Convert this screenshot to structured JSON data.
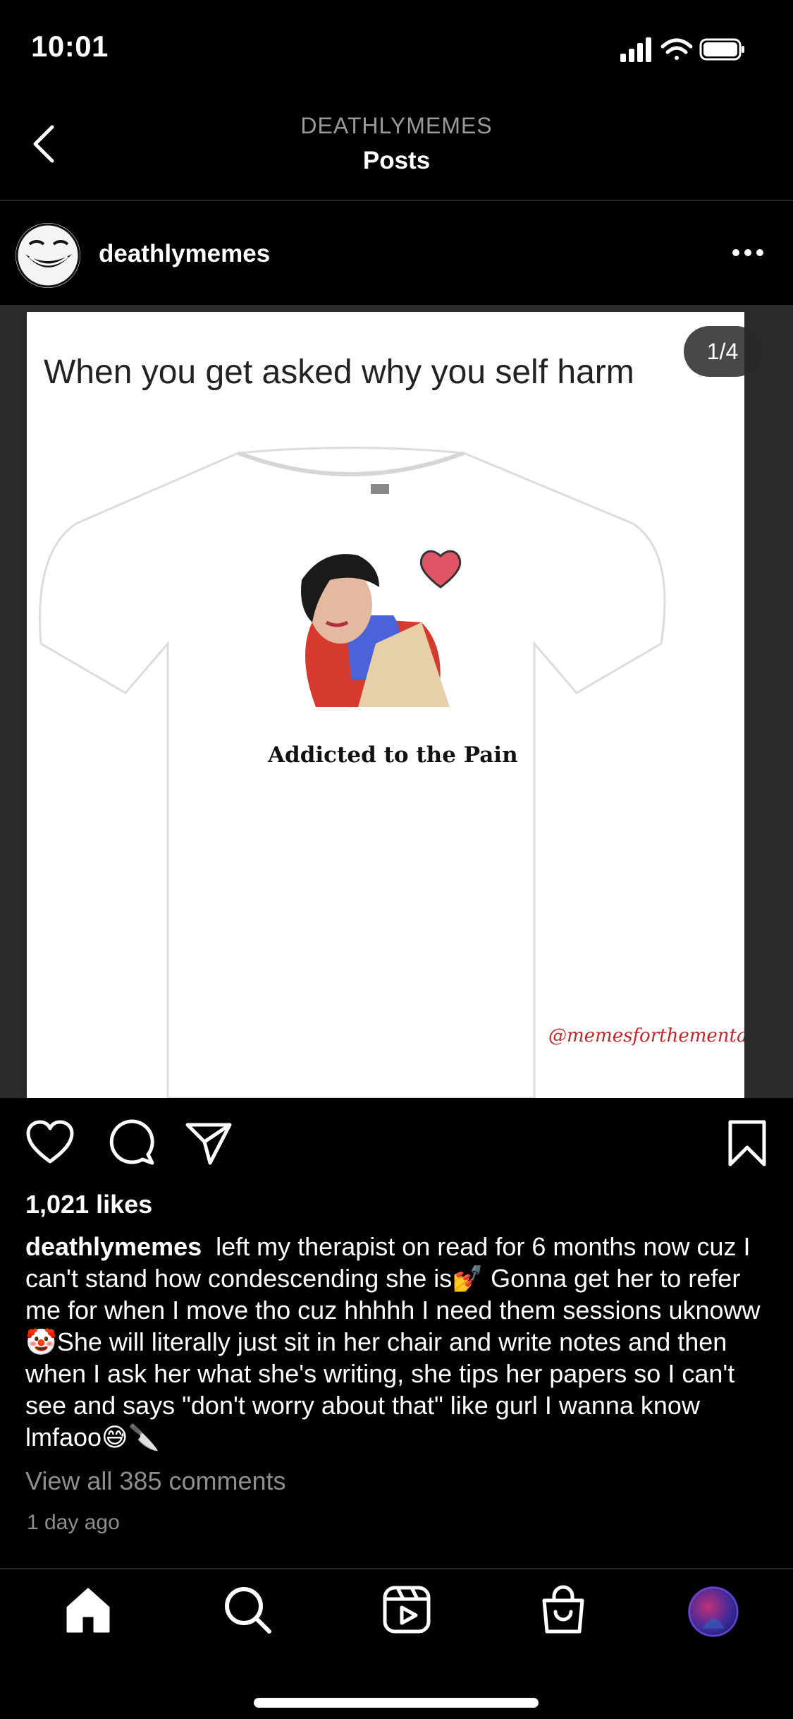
{
  "status_bar": {
    "time": "10:01"
  },
  "header": {
    "subtitle": "DEATHLYMEMES",
    "title": "Posts"
  },
  "post": {
    "username": "deathlymemes",
    "counter": "1/4",
    "image": {
      "caption": "When you get asked why you self harm",
      "shirt_text": "Addicted to the Pain",
      "watermark": "@memesforthementallychill"
    },
    "likes": "1,021 likes",
    "caption_user": "deathlymemes",
    "caption_text": "left my therapist on read for 6 months now cuz I can't stand how condescending she is💅 Gonna get her to refer me for when I move tho cuz hhhhh I need them sessions uknoww🤡She will literally just sit in her chair and write notes and then when I ask her what she's writing, she tips her papers so I can't see and says \"don't worry about that\" like gurl I wanna know lmfaoo😅🔪",
    "view_comments": "View all 385 comments",
    "time_ago": "1 day ago"
  },
  "colors": {
    "background": "#000000",
    "muted": "#8e8e8e",
    "divider": "#262626"
  },
  "icons": [
    "back-arrow-icon",
    "more-icon",
    "heart-icon",
    "comment-icon",
    "share-icon",
    "bookmark-icon",
    "home-icon",
    "search-icon",
    "reels-icon",
    "shop-icon",
    "profile-avatar"
  ]
}
